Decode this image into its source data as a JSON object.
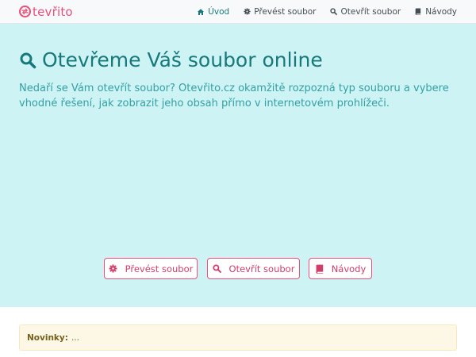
{
  "brand": {
    "name": "tevřito",
    "icon": "swap-arrows-icon",
    "color": "#e8507a"
  },
  "nav": {
    "items": [
      {
        "label": "Úvod",
        "icon": "home-icon",
        "active": true
      },
      {
        "label": "Převést soubor",
        "icon": "gear-icon",
        "active": false
      },
      {
        "label": "Otevřít soubor",
        "icon": "search-icon",
        "active": false
      },
      {
        "label": "Návody",
        "icon": "book-icon",
        "active": false
      }
    ]
  },
  "hero": {
    "title": "Otevřeme Váš soubor online",
    "title_icon": "search-icon",
    "lead": "Nedaří se Vám otevřít soubor? Otevřito.cz okamžitě rozpozná typ souboru a vybere vhodné řešení, jak zobrazit jeho obsah přímo v internetovém prohlížeči.",
    "buttons": [
      {
        "label": "Převést soubor",
        "icon": "gear-icon"
      },
      {
        "label": "Otevřít soubor",
        "icon": "search-icon"
      },
      {
        "label": "Návody",
        "icon": "book-icon"
      }
    ]
  },
  "news": {
    "label": "Novinky:",
    "text": "..."
  },
  "colors": {
    "accent": "#e8507a",
    "teal": "#17797c",
    "hero_bg": "#cdf3f4",
    "alert_bg": "#fdf7e5"
  }
}
